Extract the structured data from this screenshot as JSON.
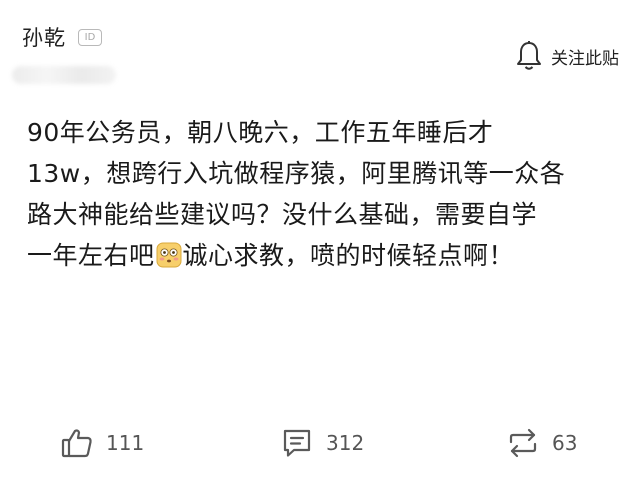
{
  "author": {
    "name": "孙乾",
    "badge": "ID"
  },
  "follow": {
    "label": "关注此贴",
    "icon": "bell-icon"
  },
  "post": {
    "line1": "90年公务员，朝八晚六，工作五年睡后才",
    "line2": "13w，想跨行入坑做程序猿，阿里腾讯等一众各",
    "line3": "路大神能给些建议吗？没什么基础，需要自学",
    "line4_before": "一年左右吧",
    "emoji": "flushed-face-emoji",
    "line4_after": "诚心求教，喷的时候轻点啊！"
  },
  "actions": {
    "likes": {
      "icon": "thumbs-up-icon",
      "count": "111"
    },
    "comments": {
      "icon": "comment-icon",
      "count": "312"
    },
    "reposts": {
      "icon": "repost-icon",
      "count": "63"
    }
  },
  "colors": {
    "text": "#1a1a1a",
    "muted": "#555555",
    "icon": "#5a5a5a",
    "emoji_fill": "#f7cf6b"
  }
}
